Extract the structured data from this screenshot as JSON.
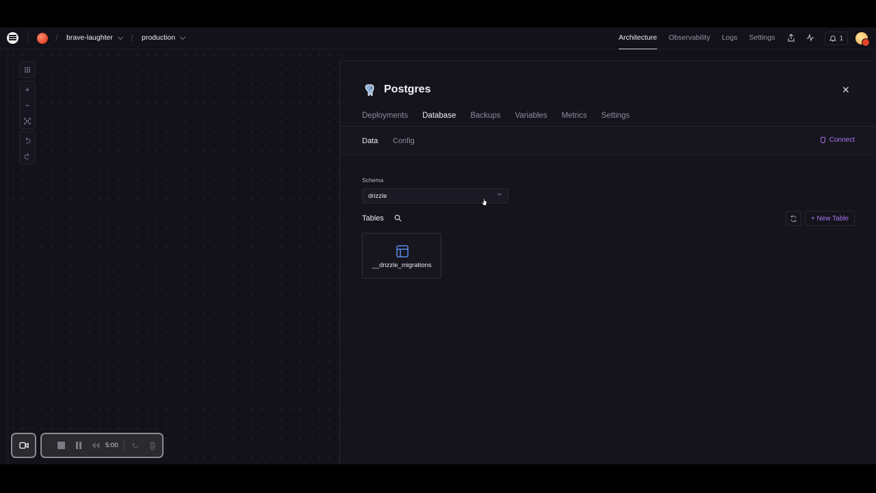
{
  "topnav": {
    "project": "brave-laughter",
    "environment": "production",
    "links": [
      "Architecture",
      "Observability",
      "Logs",
      "Settings"
    ],
    "active_link": "Architecture",
    "notification_count": "1",
    "icons": [
      "share-icon",
      "activity-icon",
      "bell-icon"
    ]
  },
  "canvas_tools": {
    "group1": [
      "grid-icon"
    ],
    "group2": [
      "zoom-in-icon",
      "zoom-out-icon",
      "fit-screen-icon"
    ],
    "group3": [
      "undo-icon",
      "redo-icon"
    ]
  },
  "panel": {
    "title": "Postgres",
    "tabs": [
      "Deployments",
      "Database",
      "Backups",
      "Variables",
      "Metrics",
      "Settings"
    ],
    "active_tab": "Database",
    "subtabs": [
      "Data",
      "Config"
    ],
    "active_subtab": "Data",
    "connect_label": "Connect",
    "schema_label": "Schema",
    "schema_value": "drizzle",
    "tables_title": "Tables",
    "new_table_label": "+ New Table",
    "tables": [
      "__drizzle_migrations"
    ]
  },
  "recorder": {
    "time": "5:00"
  },
  "colors": {
    "accent": "#a778f0",
    "background": "#13111a",
    "table_icon": "#5b8df0"
  }
}
